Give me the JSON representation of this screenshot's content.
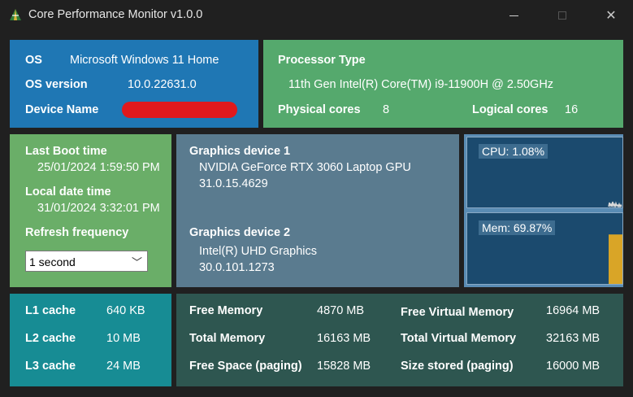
{
  "window": {
    "title": "Core Performance Monitor v1.0.0",
    "controls": {
      "minimize": "minimize",
      "maximize": "maximize",
      "close": "✕"
    }
  },
  "os": {
    "os_label": "OS",
    "os_value": "Microsoft Windows 11 Home",
    "version_label": "OS version",
    "version_value": "10.0.22631.0",
    "device_label": "Device Name",
    "device_value_redacted": true
  },
  "processor": {
    "type_label": "Processor Type",
    "type_value": "11th Gen Intel(R) Core(TM) i9-11900H @ 2.50GHz",
    "physical_label": "Physical cores",
    "physical_value": "8",
    "logical_label": "Logical cores",
    "logical_value": "16"
  },
  "boot": {
    "last_boot_label": "Last Boot time",
    "last_boot_value": "25/01/2024 1:59:50 PM",
    "local_time_label": "Local date time",
    "local_time_value": "31/01/2024 3:32:01 PM",
    "refresh_label": "Refresh frequency",
    "refresh_value": "1 second",
    "refresh_chevron": "﹀"
  },
  "graphics": {
    "device1_label": "Graphics device 1",
    "device1_name": "NVIDIA GeForce RTX 3060 Laptop GPU",
    "device1_version": "31.0.15.4629",
    "device2_label": "Graphics device 2",
    "device2_name": "Intel(R) UHD Graphics",
    "device2_version": "30.0.101.1273"
  },
  "monitors": {
    "cpu_label": "CPU: 1.08%",
    "cpu_value_pct": 1.08,
    "cpu_color": "#d9d9d9",
    "mem_label": "Mem: 69.87%",
    "mem_value_pct": 69.87,
    "mem_color": "#d9a527"
  },
  "cache": {
    "l1_label": "L1 cache",
    "l1_value": "640 KB",
    "l2_label": "L2 cache",
    "l2_value": "10 MB",
    "l3_label": "L3 cache",
    "l3_value": "24 MB"
  },
  "memory": {
    "free_mem_label": "Free Memory",
    "free_mem_value": "4870 MB",
    "total_mem_label": "Total Memory",
    "total_mem_value": "16163 MB",
    "free_space_label": "Free Space (paging)",
    "free_space_value": "15828 MB",
    "free_virtual_label": "Free Virtual Memory",
    "free_virtual_value": "16964 MB",
    "total_virtual_label": "Total Virtual Memory",
    "total_virtual_value": "32163 MB",
    "size_stored_label": "Size stored (paging)",
    "size_stored_value": "16000 MB"
  },
  "colors": {
    "os_panel": "#1f77b4",
    "processor_panel": "#55a96d",
    "boot_panel": "#6aae68",
    "graphics_panel": "#5a7b8f",
    "cache_panel": "#178c94",
    "memory_panel": "#2e5650",
    "redaction": "#e0191d"
  }
}
